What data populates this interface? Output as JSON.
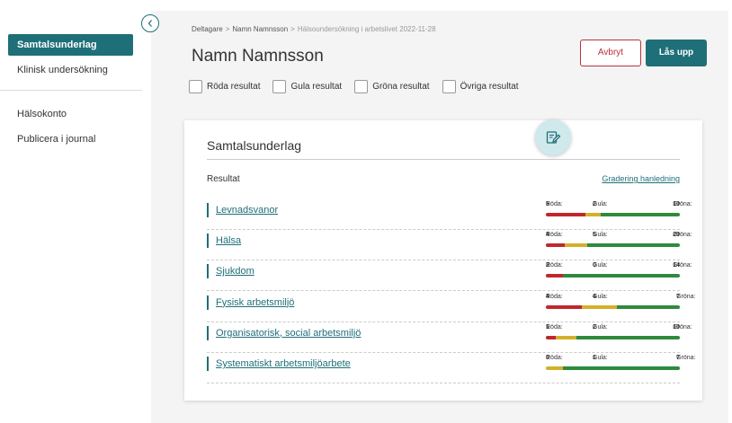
{
  "sidebar": {
    "items": [
      {
        "label": "Samtalsunderlag",
        "active": true
      },
      {
        "label": "Klinisk undersökning",
        "active": false
      },
      {
        "label": "Hälsokonto",
        "active": false
      },
      {
        "label": "Publicera i journal",
        "active": false
      }
    ]
  },
  "breadcrumb": {
    "items": [
      "Deltagare",
      "Namn Namnsson",
      "Hälsoundersökning i arbetslivet 2022-11-28"
    ]
  },
  "header": {
    "title": "Namn Namnsson",
    "cancel_label": "Avbryt",
    "unlock_label": "Lås upp"
  },
  "filters": [
    "Röda resultat",
    "Gula resultat",
    "Gröna resultat",
    "Övriga resultat"
  ],
  "card": {
    "title": "Samtalsunderlag",
    "results_label": "Resultat",
    "grading_link": "Gradering hanledning",
    "count_labels": {
      "red": "Röda:",
      "yellow": "Gula:",
      "green": "Gröna:"
    },
    "rows": [
      {
        "label": "Levnadsvanor",
        "red": 5,
        "yellow": 2,
        "green": 10
      },
      {
        "label": "Hälsa",
        "red": 4,
        "yellow": 5,
        "green": 20
      },
      {
        "label": "Sjukdom",
        "red": 2,
        "yellow": 0,
        "green": 14
      },
      {
        "label": "Fysisk arbetsmiljö",
        "red": 4,
        "yellow": 4,
        "green": 7
      },
      {
        "label": "Organisatorisk, social arbetsmiljö",
        "red": 1,
        "yellow": 2,
        "green": 10
      },
      {
        "label": "Systematiskt arbetsmiljöarbete",
        "red": 0,
        "yellow": 1,
        "green": 7
      }
    ]
  },
  "colors": {
    "accent": "#1f6f78",
    "red": "#c0272d",
    "yellow": "#d4b02a",
    "green": "#2f8a3e",
    "cancel": "#b8333a"
  },
  "icons": {
    "collapse": "chevron-left-icon",
    "edit": "edit-note-icon"
  }
}
